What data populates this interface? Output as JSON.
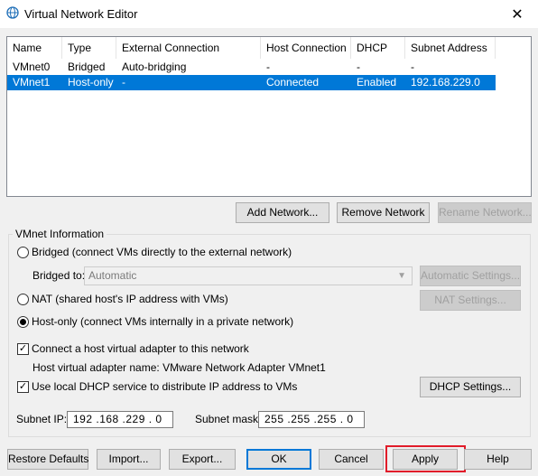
{
  "window": {
    "title": "Virtual Network Editor",
    "close_glyph": "✕"
  },
  "table": {
    "columns": [
      "Name",
      "Type",
      "External Connection",
      "Host Connection",
      "DHCP",
      "Subnet Address"
    ],
    "rows": [
      {
        "name": "VMnet0",
        "type": "Bridged",
        "external": "Auto-bridging",
        "host": "-",
        "dhcp": "-",
        "subnet": "-"
      },
      {
        "name": "VMnet1",
        "type": "Host-only",
        "external": "-",
        "host": "Connected",
        "dhcp": "Enabled",
        "subnet": "192.168.229.0",
        "selected": true
      }
    ]
  },
  "table_buttons": {
    "add": "Add Network...",
    "remove": "Remove Network",
    "rename": "Rename Network..."
  },
  "vmnet_info": {
    "label": "VMnet Information",
    "bridged_label": "Bridged (connect VMs directly to the external network)",
    "bridged_to_label": "Bridged to:",
    "bridged_to_value": "Automatic",
    "automatic_settings": "Automatic Settings...",
    "nat_label": "NAT (shared host's IP address with VMs)",
    "nat_settings": "NAT Settings...",
    "hostonly_label": "Host-only (connect VMs internally in a private network)",
    "connect_adapter_label": "Connect a host virtual adapter to this network",
    "adapter_name_label": "Host virtual adapter name: VMware Network Adapter VMnet1",
    "dhcp_label": "Use local DHCP service to distribute IP address to VMs",
    "dhcp_settings": "DHCP Settings...",
    "subnet_ip_label": "Subnet IP:",
    "subnet_ip": "192 .168 .229 .  0",
    "subnet_mask_label": "Subnet mask:",
    "subnet_mask": "255 .255 .255 .  0",
    "selected_mode": "host-only",
    "connect_adapter_checked": true,
    "dhcp_checked": true
  },
  "footer": {
    "restore": "Restore Defaults",
    "import": "Import...",
    "export": "Export...",
    "ok": "OK",
    "cancel": "Cancel",
    "apply": "Apply",
    "help": "Help"
  },
  "colors": {
    "selection": "#0078d7",
    "highlight": "#e11c2a"
  },
  "icons": {
    "title": "network-globe-icon",
    "check": "✓"
  }
}
